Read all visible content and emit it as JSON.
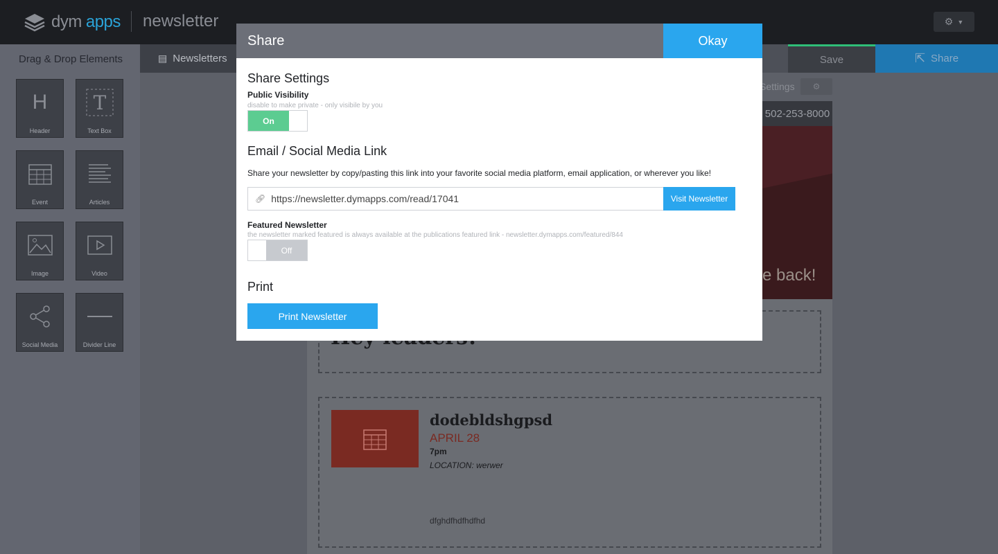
{
  "header": {
    "brand_main": "dym",
    "brand_accent": "apps",
    "app_title": "newsletter"
  },
  "sidebar": {
    "title": "Drag & Drop Elements",
    "tiles": [
      {
        "label": "Header",
        "icon": "header-icon"
      },
      {
        "label": "Text Box",
        "icon": "text-box-icon"
      },
      {
        "label": "Event",
        "icon": "calendar-icon"
      },
      {
        "label": "Articles",
        "icon": "articles-icon"
      },
      {
        "label": "Image",
        "icon": "image-icon"
      },
      {
        "label": "Video",
        "icon": "video-icon"
      },
      {
        "label": "Social Media",
        "icon": "share-network-icon"
      },
      {
        "label": "Divider Line",
        "icon": "divider-icon"
      }
    ]
  },
  "nav": {
    "newsletters_label": "Newsletters",
    "save_label": "Save",
    "share_label": "Share"
  },
  "canvas": {
    "settings_label": "Settings",
    "phone": "502-253-8000",
    "hero_text": "e back!",
    "greeting": "Hey leaders!",
    "event": {
      "title": "dodebldshgpsd",
      "date": "APRIL 28",
      "time": "7pm",
      "location": "LOCATION: werwer",
      "description": "dfghdfhdfhdfhd"
    }
  },
  "modal": {
    "title": "Share",
    "okay_label": "Okay",
    "share_settings_title": "Share Settings",
    "public_visibility_label": "Public Visibility",
    "public_visibility_hint": "disable to make private - only visibile by you",
    "public_visibility_state": "On",
    "email_social_title": "Email / Social Media Link",
    "email_social_desc": "Share your newsletter by copy/pasting this link into your favorite social media platform, email application, or wherever you like!",
    "link_url": "https://newsletter.dymapps.com/read/17041",
    "visit_label": "Visit Newsletter",
    "featured_label": "Featured Newsletter",
    "featured_hint": "the newsletter marked featured is always available at the publications featured link - newsletter.dymapps.com/featured/844",
    "featured_state": "Off",
    "print_title": "Print",
    "print_label": "Print Newsletter"
  },
  "colors": {
    "accent_blue": "#2aa6ee",
    "toggle_on": "#5ccc91",
    "event_red": "#7a2a22"
  }
}
